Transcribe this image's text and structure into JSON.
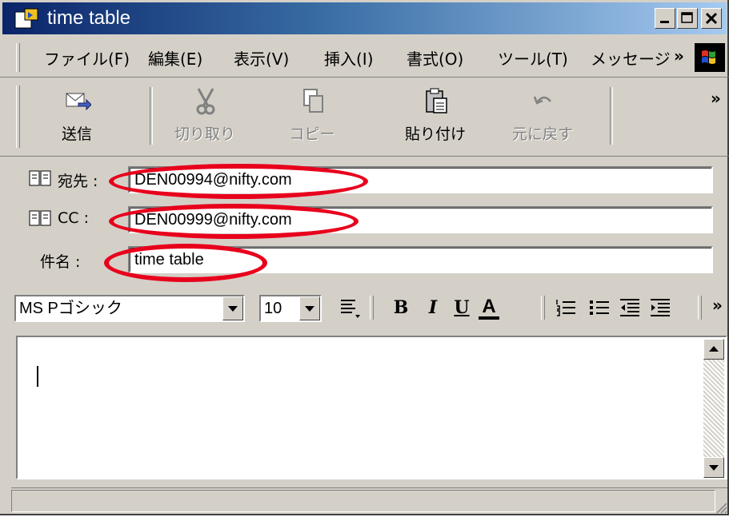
{
  "window": {
    "title": "time table"
  },
  "menu": [
    "ファイル(F)",
    "編集(E)",
    "表示(V)",
    "挿入(I)",
    "書式(O)",
    "ツール(T)",
    "メッセージ"
  ],
  "more_glyph": "»",
  "toolbar": {
    "send": "送信",
    "cut": "切り取り",
    "copy": "コピー",
    "paste": "貼り付け",
    "undo": "元に戻す"
  },
  "fields": {
    "to": {
      "label": "宛先 :",
      "value": "DEN00994@nifty.com"
    },
    "cc": {
      "label": "CC :",
      "value": "DEN00999@nifty.com"
    },
    "subject": {
      "label": "件名 :",
      "value": "time table"
    }
  },
  "format": {
    "font": "MS Pゴシック",
    "size": "10",
    "bold": "B",
    "italic": "I",
    "underline": "U",
    "color": "A"
  },
  "body": {
    "text": ""
  },
  "colors": {
    "annotation": "#e8001c",
    "titlebar_start": "#0a246a",
    "face": "#d4d0c8"
  },
  "icons": [
    "envelope-send-icon",
    "scissors-icon",
    "copy-icon",
    "paste-icon",
    "undo-icon",
    "address-book-icon",
    "windows-logo-icon"
  ]
}
